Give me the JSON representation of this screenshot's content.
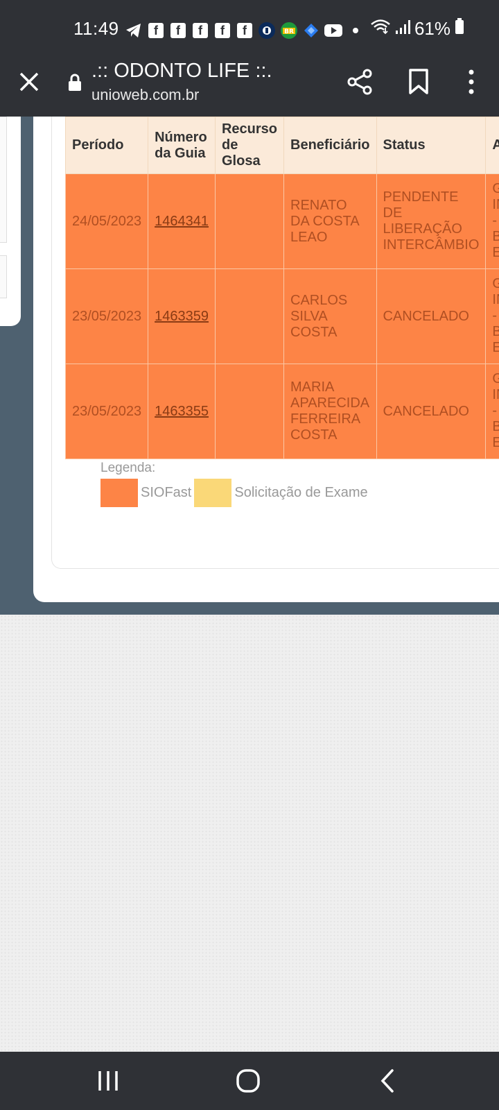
{
  "status_bar": {
    "time": "11:49",
    "battery": "61%",
    "notification_icons": [
      "telegram-icon",
      "facebook-icon",
      "facebook-icon",
      "facebook-icon",
      "facebook-icon",
      "facebook-icon",
      "brazil-flag-icon",
      "br-petrobras-icon",
      "diamond-icon",
      "youtube-icon",
      "dot-icon"
    ]
  },
  "browser": {
    "title": ".:: ODONTO LIFE ::.",
    "url": "unioweb.com.br"
  },
  "table": {
    "headers": [
      "Período",
      "Número da Guia",
      "Recurso de Glosa",
      "Beneficiário",
      "Status",
      "Atendimento"
    ],
    "rows": [
      {
        "periodo": "24/05/2023",
        "numero": "1464341",
        "recurso": "",
        "beneficiario": "RENATO DA COSTA LEAO",
        "status": "PENDENTE DE LIBERAÇÃO INTERCÂMBIO",
        "atendimento": "GUIA INTERCÂMBIO - BENEFICIÁRIO EXTERNO"
      },
      {
        "periodo": "23/05/2023",
        "numero": "1463359",
        "recurso": "",
        "beneficiario": "CARLOS SILVA COSTA",
        "status": "CANCELADO",
        "atendimento": "GUIA INTERCÂMBIO - BENEFICIÁRIO EXTERNO"
      },
      {
        "periodo": "23/05/2023",
        "numero": "1463355",
        "recurso": "",
        "beneficiario": "MARIA APARECIDA FERREIRA COSTA",
        "status": "CANCELADO",
        "atendimento": "GUIA INTERCÂMBIO - BENEFICIÁRIO EXTERNO"
      }
    ]
  },
  "legend": {
    "label": "Legenda:",
    "items": [
      {
        "label": "SIOFast",
        "color": "#fd8446"
      },
      {
        "label": "Solicitação de Exame",
        "color": "#fad878"
      }
    ]
  },
  "colors": {
    "row_highlight": "#fd8446",
    "header_bg": "#fbead9",
    "background_slate": "#4e6170",
    "system_bar": "#2f3136"
  }
}
